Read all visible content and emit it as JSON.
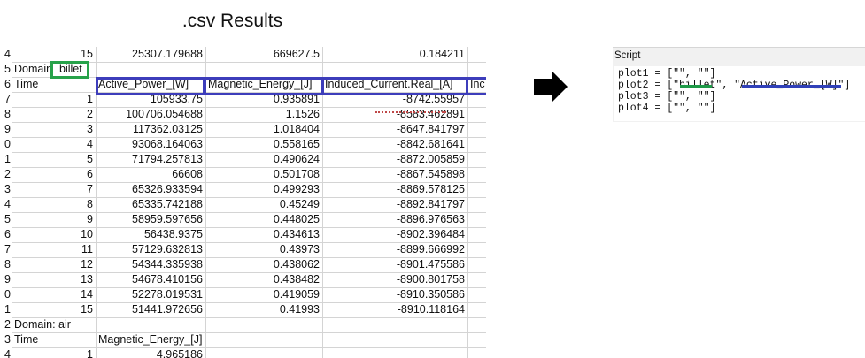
{
  "title": ".csv Results",
  "sheet": {
    "rows": [
      {
        "rh": "4",
        "c1": "15",
        "c2": "25307.179688",
        "c3": "669627.5",
        "c4": "0.184211",
        "c5": ""
      },
      {
        "rh": "5",
        "c1": "Domain",
        "c1b": "billet",
        "c2": "",
        "c3": "",
        "c4": "",
        "c5": ""
      },
      {
        "rh": "6",
        "c1": "Time",
        "c2": "Active_Power_[W]",
        "c3": "Magnetic_Energy_[J]",
        "c4": "Induced_Current.Real_[A]",
        "c5": "Inc"
      },
      {
        "rh": "7",
        "c1": "1",
        "c2": "105933.75",
        "c3": "0.935891",
        "c4": "-8742.55957",
        "c5": ""
      },
      {
        "rh": "8",
        "c1": "2",
        "c2": "100706.054688",
        "c3": "1.1526",
        "c4": "-8583.462891",
        "c5": ""
      },
      {
        "rh": "9",
        "c1": "3",
        "c2": "117362.03125",
        "c3": "1.018404",
        "c4": "-8647.841797",
        "c5": ""
      },
      {
        "rh": "0",
        "c1": "4",
        "c2": "93068.164063",
        "c3": "0.558165",
        "c4": "-8842.681641",
        "c5": ""
      },
      {
        "rh": "1",
        "c1": "5",
        "c2": "71794.257813",
        "c3": "0.490624",
        "c4": "-8872.005859",
        "c5": ""
      },
      {
        "rh": "2",
        "c1": "6",
        "c2": "66608",
        "c3": "0.501708",
        "c4": "-8867.545898",
        "c5": ""
      },
      {
        "rh": "3",
        "c1": "7",
        "c2": "65326.933594",
        "c3": "0.499293",
        "c4": "-8869.578125",
        "c5": ""
      },
      {
        "rh": "4",
        "c1": "8",
        "c2": "65335.742188",
        "c3": "0.45249",
        "c4": "-8892.841797",
        "c5": ""
      },
      {
        "rh": "5",
        "c1": "9",
        "c2": "58959.597656",
        "c3": "0.448025",
        "c4": "-8896.976563",
        "c5": ""
      },
      {
        "rh": "6",
        "c1": "10",
        "c2": "56438.9375",
        "c3": "0.434613",
        "c4": "-8902.396484",
        "c5": ""
      },
      {
        "rh": "7",
        "c1": "11",
        "c2": "57129.632813",
        "c3": "0.43973",
        "c4": "-8899.666992",
        "c5": ""
      },
      {
        "rh": "8",
        "c1": "12",
        "c2": "54344.335938",
        "c3": "0.438062",
        "c4": "-8901.475586",
        "c5": ""
      },
      {
        "rh": "9",
        "c1": "13",
        "c2": "54678.410156",
        "c3": "0.438482",
        "c4": "-8900.801758",
        "c5": ""
      },
      {
        "rh": "0",
        "c1": "14",
        "c2": "52278.019531",
        "c3": "0.419059",
        "c4": "-8910.350586",
        "c5": ""
      },
      {
        "rh": "1",
        "c1": "15",
        "c2": "51441.972656",
        "c3": "0.41993",
        "c4": "-8910.118164",
        "c5": ""
      },
      {
        "rh": "2",
        "c1": "Domain: air",
        "c2": "",
        "c3": "",
        "c4": "",
        "c5": ""
      },
      {
        "rh": "3",
        "c1": "Time",
        "c2": "Magnetic_Energy_[J]",
        "c3": "",
        "c4": "",
        "c5": ""
      },
      {
        "rh": "4",
        "c1": "1",
        "c2": "4.965186",
        "c3": "",
        "c4": "",
        "c5": ""
      }
    ]
  },
  "script_panel": {
    "title": "Script",
    "lines": [
      "plot1 = [\"\", \"\"]",
      "plot2 = [\"billet\", \"Active_Power_[W]\"]",
      "plot3 = [\"\", \"\"]",
      "plot4 = [\"\", \"\"]"
    ]
  },
  "colors": {
    "green_highlight": "#27a24a",
    "blue_highlight": "#3d3dbb",
    "arrow": "#000000"
  },
  "icons": {
    "arrow": "right-arrow-icon"
  }
}
